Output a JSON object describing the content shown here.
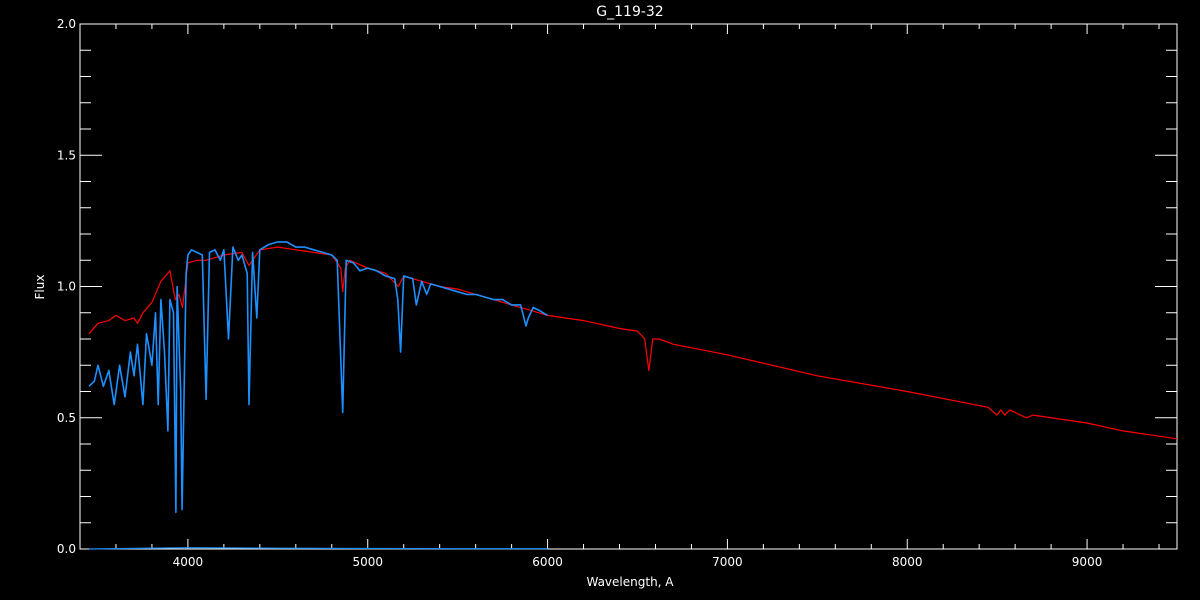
{
  "chart_data": {
    "type": "line",
    "title": "G_119-32",
    "xlabel": "Wavelength, A",
    "ylabel": "Flux",
    "xlim": [
      3400,
      9500
    ],
    "ylim": [
      0.0,
      2.0
    ],
    "grid": false,
    "x_ticks": [
      4000,
      5000,
      6000,
      7000,
      8000,
      9000
    ],
    "y_ticks": [
      "0.0",
      "0.5",
      "1.0",
      "1.5",
      "2.0"
    ],
    "colors": {
      "background": "#000000",
      "axes": "#ffffff",
      "model": "#ff0000",
      "observed": "#1e90ff"
    },
    "series": [
      {
        "color": "#ff0000",
        "x": [
          3450,
          3500,
          3560,
          3600,
          3650,
          3700,
          3720,
          3750,
          3800,
          3850,
          3900,
          3930,
          3950,
          3970,
          4000,
          4050,
          4100,
          4200,
          4300,
          4340,
          4400,
          4500,
          4600,
          4700,
          4800,
          4850,
          4861,
          4875,
          4900,
          5000,
          5100,
          5170,
          5200,
          5300,
          5400,
          5500,
          5600,
          5700,
          5800,
          5900,
          6000,
          6200,
          6400,
          6500,
          6540,
          6563,
          6585,
          6620,
          6700,
          7000,
          7500,
          8000,
          8450,
          8498,
          8520,
          8542,
          8570,
          8662,
          8700,
          9000,
          9200,
          9500
        ],
        "y": [
          0.82,
          0.86,
          0.87,
          0.89,
          0.87,
          0.88,
          0.86,
          0.9,
          0.94,
          1.02,
          1.06,
          0.95,
          0.97,
          0.92,
          1.09,
          1.1,
          1.1,
          1.12,
          1.13,
          1.08,
          1.14,
          1.15,
          1.14,
          1.13,
          1.12,
          1.07,
          0.98,
          1.07,
          1.1,
          1.07,
          1.05,
          1.0,
          1.04,
          1.02,
          1.0,
          0.99,
          0.97,
          0.95,
          0.93,
          0.91,
          0.89,
          0.87,
          0.84,
          0.83,
          0.8,
          0.68,
          0.8,
          0.8,
          0.78,
          0.74,
          0.66,
          0.6,
          0.54,
          0.51,
          0.53,
          0.51,
          0.53,
          0.5,
          0.51,
          0.48,
          0.45,
          0.42
        ]
      },
      {
        "color": "#1e90ff",
        "x": [
          3450,
          3480,
          3500,
          3530,
          3560,
          3590,
          3620,
          3650,
          3680,
          3700,
          3720,
          3750,
          3770,
          3800,
          3820,
          3835,
          3850,
          3870,
          3889,
          3900,
          3920,
          3933,
          3940,
          3960,
          3968,
          3990,
          4000,
          4020,
          4050,
          4080,
          4101,
          4120,
          4150,
          4180,
          4200,
          4226,
          4250,
          4280,
          4300,
          4330,
          4340,
          4360,
          4383,
          4400,
          4450,
          4500,
          4550,
          4600,
          4650,
          4700,
          4750,
          4800,
          4830,
          4861,
          4880,
          4920,
          4957,
          5000,
          5050,
          5100,
          5150,
          5167,
          5183,
          5200,
          5250,
          5270,
          5300,
          5328,
          5350,
          5400,
          5450,
          5500,
          5550,
          5600,
          5650,
          5700,
          5750,
          5800,
          5850,
          5880,
          5893,
          5920,
          5950,
          6000
        ],
        "y": [
          0.62,
          0.64,
          0.7,
          0.62,
          0.68,
          0.55,
          0.7,
          0.58,
          0.75,
          0.66,
          0.78,
          0.55,
          0.82,
          0.7,
          0.9,
          0.55,
          0.95,
          0.75,
          0.45,
          0.95,
          0.9,
          0.14,
          1.0,
          0.6,
          0.15,
          1.05,
          1.12,
          1.14,
          1.13,
          1.12,
          0.57,
          1.13,
          1.14,
          1.1,
          1.14,
          0.8,
          1.15,
          1.1,
          1.12,
          1.05,
          0.55,
          1.13,
          0.88,
          1.14,
          1.16,
          1.17,
          1.17,
          1.15,
          1.15,
          1.14,
          1.13,
          1.12,
          1.1,
          0.52,
          1.1,
          1.09,
          1.06,
          1.07,
          1.06,
          1.04,
          1.03,
          0.95,
          0.75,
          1.04,
          1.03,
          0.93,
          1.02,
          0.97,
          1.01,
          1.0,
          0.99,
          0.98,
          0.97,
          0.97,
          0.96,
          0.95,
          0.95,
          0.93,
          0.93,
          0.85,
          0.88,
          0.92,
          0.91,
          0.89
        ]
      },
      {
        "color": "#1e90ff",
        "x": [
          3450,
          4000,
          4500,
          5000,
          5500,
          6000
        ],
        "y": [
          0.0,
          0.005,
          0.003,
          0.002,
          0.001,
          0.001
        ]
      }
    ]
  }
}
